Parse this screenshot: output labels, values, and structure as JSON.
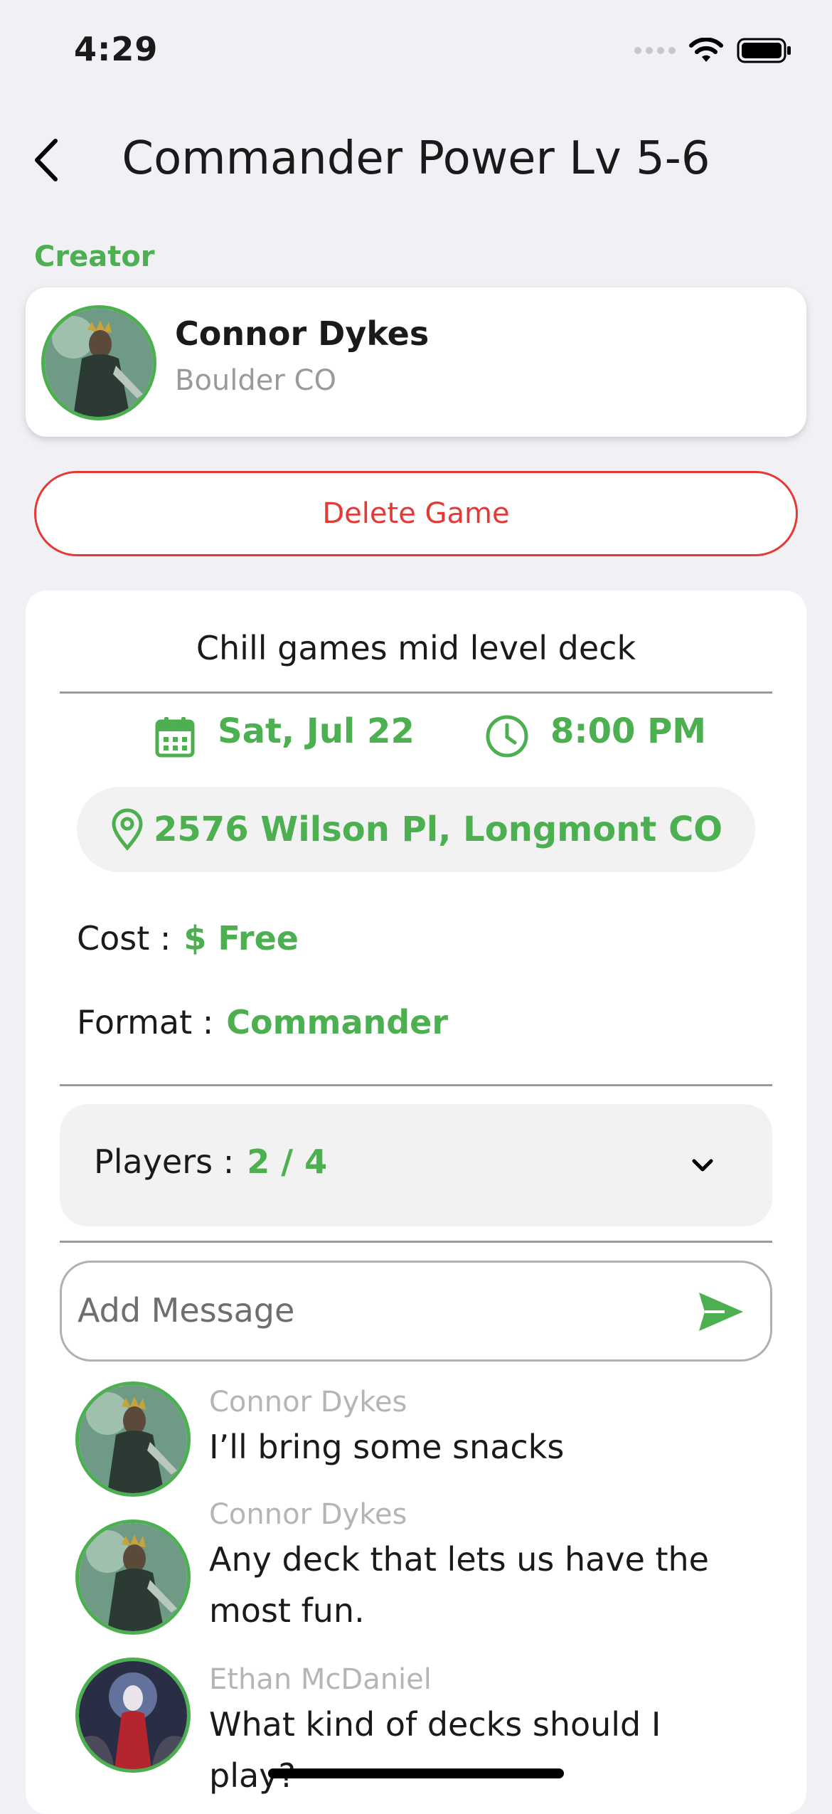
{
  "status_bar": {
    "time": "4:29"
  },
  "header": {
    "title": "Commander Power Lv 5-6"
  },
  "creator": {
    "section_label": "Creator",
    "name": "Connor Dykes",
    "location": "Boulder CO"
  },
  "delete_button_label": "Delete Game",
  "game": {
    "description": "Chill games mid level deck",
    "date": "Sat, Jul 22",
    "time": "8:00 PM",
    "address": "2576 Wilson Pl, Longmont CO",
    "cost_label": "Cost :",
    "cost_value": "$ Free",
    "format_label": "Format :",
    "format_value": "Commander",
    "players_label": "Players :",
    "players_value": "2 / 4"
  },
  "message_input": {
    "placeholder": "Add Message"
  },
  "messages": [
    {
      "author": "Connor Dykes",
      "text": "I’ll bring some snacks"
    },
    {
      "author": "Connor Dykes",
      "text": "Any deck that lets us have the most fun."
    },
    {
      "author": "Ethan  McDaniel",
      "text": "What kind of decks should I play?"
    }
  ],
  "colors": {
    "accent": "#4CAF50",
    "danger": "#E53935",
    "background": "#F0F0F5"
  }
}
